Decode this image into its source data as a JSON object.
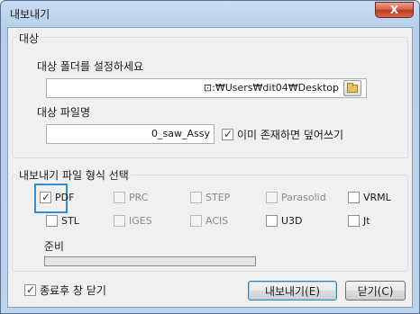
{
  "window": {
    "title": "내보내기",
    "close_symbol": "X"
  },
  "target_group": {
    "label": "대상",
    "folder_label": "대상 폴더를 설정하세요",
    "folder_value": "⊡:₩Users₩dit04₩Desktop",
    "filename_label": "대상 파일명",
    "filename_value": "0_saw_Assy",
    "overwrite_label": "이미 존재하면 덮어쓰기",
    "overwrite_checked": true
  },
  "format_group": {
    "label": "내보내기 파일 형식 선택",
    "formats_row1": [
      {
        "label": "PDF",
        "checked": true,
        "enabled": true
      },
      {
        "label": "PRC",
        "checked": false,
        "enabled": false
      },
      {
        "label": "STEP",
        "checked": false,
        "enabled": false
      },
      {
        "label": "Parasolid",
        "checked": false,
        "enabled": false
      },
      {
        "label": "VRML",
        "checked": false,
        "enabled": true
      }
    ],
    "formats_row2": [
      {
        "label": "STL",
        "checked": false,
        "enabled": true
      },
      {
        "label": "IGES",
        "checked": false,
        "enabled": false
      },
      {
        "label": "ACIS",
        "checked": false,
        "enabled": false
      },
      {
        "label": "U3D",
        "checked": false,
        "enabled": true
      },
      {
        "label": "Jt",
        "checked": false,
        "enabled": true
      }
    ],
    "status_label": "준비",
    "progress": 0
  },
  "footer": {
    "close_after_label": "종료후 창 닫기",
    "close_after_checked": true,
    "export_button": "내보내기(E)",
    "close_button": "닫기(C)"
  }
}
